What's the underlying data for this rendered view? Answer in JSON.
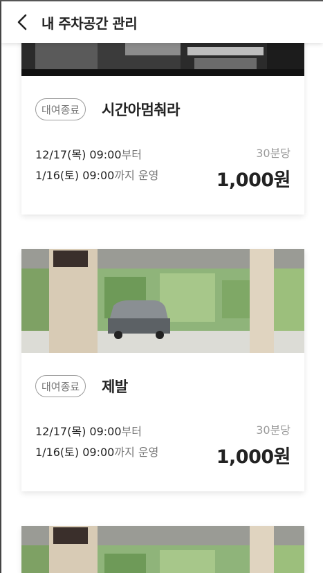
{
  "header": {
    "title": "내 주차공간 관리"
  },
  "cards": [
    {
      "badge": "대여종료",
      "name": "시간아멈춰라",
      "start_date": "12/17(목) 09:00",
      "start_suffix": "부터",
      "end_date": "1/16(토) 09:00",
      "end_suffix": "까지 운영",
      "unit": "30분당",
      "price": "1,000원"
    },
    {
      "badge": "대여종료",
      "name": "제발",
      "start_date": "12/17(목) 09:00",
      "start_suffix": "부터",
      "end_date": "1/16(토) 09:00",
      "end_suffix": "까지 운영",
      "unit": "30분당",
      "price": "1,000원"
    }
  ],
  "colors": {
    "muted": "#777777",
    "text": "#222222",
    "badge_border": "#9a9a9a"
  },
  "icons": {
    "back": "chevron-left-icon"
  }
}
